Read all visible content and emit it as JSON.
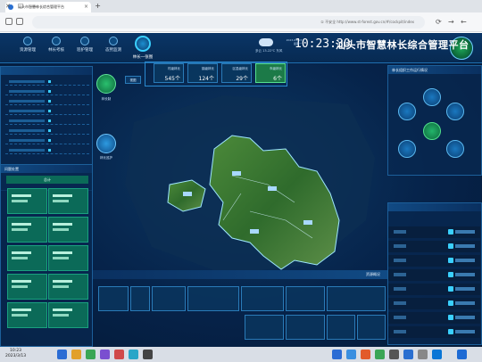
{
  "browser": {
    "tab_title": "汕头市智慧林长综合管理平台",
    "url": "① 不安全  http://www.st-forest.gov.cn/#/cockpit/index",
    "new_tab_symbol": "+",
    "close_symbol": "×",
    "minimize_symbol": "—",
    "maximize_symbol": "☐",
    "window_close_symbol": "✕"
  },
  "header": {
    "title": "汕头市智慧林长综合管理平台",
    "clock": "10:23:30",
    "date": "2023-03-13 星期一",
    "weather": "多云 13-22℃ 东风",
    "home_label": "林长一张图",
    "nav": [
      {
        "label": "态势监测"
      },
      {
        "label": "巡护管理"
      },
      {
        "label": "林长考核"
      },
      {
        "label": "资源管理"
      }
    ]
  },
  "panels": {
    "right_top_title": "林长组织工作运行情况",
    "right_bottom_title": "",
    "left_top_title": "",
    "left_bottom_title": "问题处置",
    "left_bottom_sub": "总计",
    "bottom_title": "资源概况",
    "side_small": "视图"
  },
  "side_buttons": [
    {
      "label": "林长制"
    },
    {
      "label": "林长巡护"
    }
  ],
  "kpis": [
    {
      "label": "市级林长",
      "value": "6个"
    },
    {
      "label": "区县级林长",
      "value": "29个"
    },
    {
      "label": "镇级林长",
      "value": "124个"
    },
    {
      "label": "村级林长",
      "value": "545个"
    }
  ],
  "bottom_cards": [
    {
      "label": "",
      "value": ""
    },
    {
      "label": "",
      "value": ""
    },
    {
      "label": "",
      "value": ""
    },
    {
      "label": "",
      "value": ""
    },
    {
      "label": "",
      "value": ""
    },
    {
      "label": "",
      "value": ""
    },
    {
      "label": "",
      "value": ""
    },
    {
      "label": "",
      "value": ""
    },
    {
      "label": "",
      "value": ""
    },
    {
      "label": "",
      "value": ""
    },
    {
      "label": "",
      "value": ""
    }
  ],
  "taskbar": {
    "time": "10:23",
    "date": "2023/3/13"
  },
  "colors": {
    "bg": "#06234a",
    "accent": "#3ad0ff",
    "green": "#1c7a48",
    "teal": "#0b6a58"
  }
}
